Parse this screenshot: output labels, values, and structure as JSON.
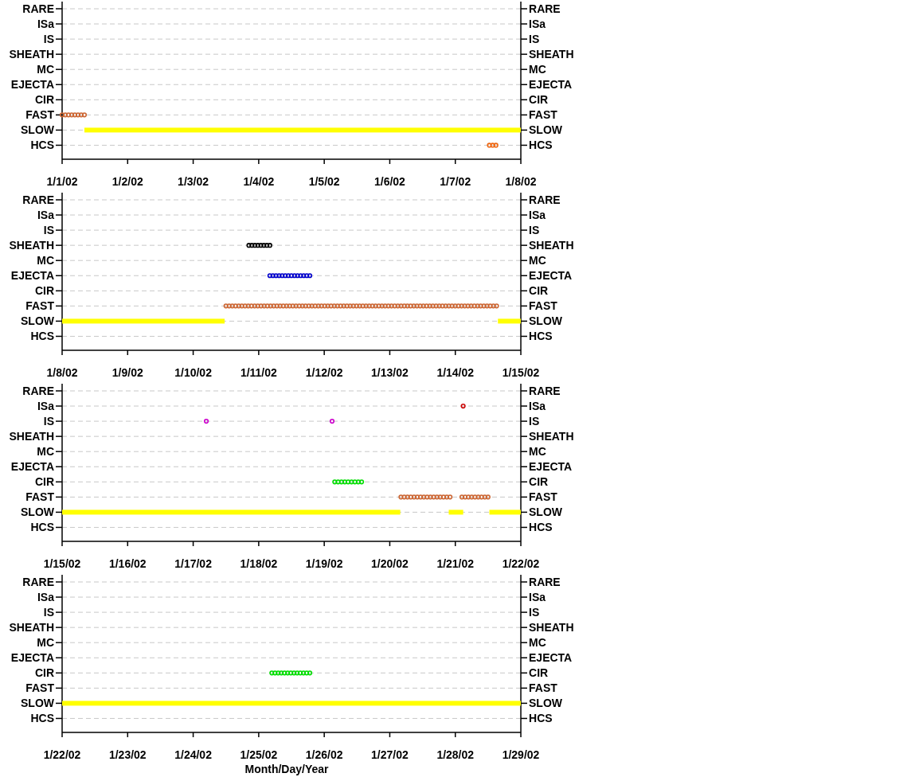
{
  "panels": [
    {
      "left_labels": [
        "RARE",
        "ISa",
        "IS",
        "SHEATH",
        "MC",
        "EJECTA",
        "CIR",
        "FAST",
        "SLOW",
        "HCS"
      ],
      "right_labels": [
        "RARE",
        "ISa",
        "IS",
        "SHEATH",
        "MC",
        "EJECTA",
        "CIR",
        "FAST",
        "SLOW",
        "HCS"
      ],
      "x_labels": [
        "1/1/02",
        "1/2/02",
        "1/3/02",
        "1/4/02",
        "1/5/02",
        "1/6/02",
        "1/7/02",
        "1/8/02"
      ]
    },
    {
      "left_labels": [
        "RARE",
        "ISa",
        "IS",
        "SHEATH",
        "MC",
        "EJECTA",
        "CIR",
        "FAST",
        "SLOW",
        "HCS"
      ],
      "right_labels": [
        "RARE",
        "ISa",
        "IS",
        "SHEATH",
        "MC",
        "EJECTA",
        "CIR",
        "FAST",
        "SLOW",
        "HCS"
      ],
      "x_labels": [
        "1/8/02",
        "1/9/02",
        "1/10/02",
        "1/11/02",
        "1/12/02",
        "1/13/02",
        "1/14/02",
        "1/15/02"
      ]
    },
    {
      "left_labels": [
        "RARE",
        "ISa",
        "IS",
        "SHEATH",
        "MC",
        "EJECTA",
        "CIR",
        "FAST",
        "SLOW",
        "HCS"
      ],
      "right_labels": [
        "RARE",
        "ISa",
        "IS",
        "SHEATH",
        "MC",
        "EJECTA",
        "CIR",
        "FAST",
        "SLOW",
        "HCS"
      ],
      "x_labels": [
        "1/15/02",
        "1/16/02",
        "1/17/02",
        "1/18/02",
        "1/19/02",
        "1/20/02",
        "1/21/02",
        "1/22/02"
      ]
    },
    {
      "left_labels": [
        "RARE",
        "ISa",
        "IS",
        "SHEATH",
        "MC",
        "EJECTA",
        "CIR",
        "FAST",
        "SLOW",
        "HCS"
      ],
      "right_labels": [
        "RARE",
        "ISa",
        "IS",
        "SHEATH",
        "MC",
        "EJECTA",
        "CIR",
        "FAST",
        "SLOW",
        "HCS"
      ],
      "x_labels": [
        "1/22/02",
        "1/23/02",
        "1/24/02",
        "1/25/02",
        "1/26/02",
        "1/27/02",
        "1/28/02",
        "1/29/02"
      ]
    }
  ],
  "x_axis_title": "Month/Day/Year"
}
